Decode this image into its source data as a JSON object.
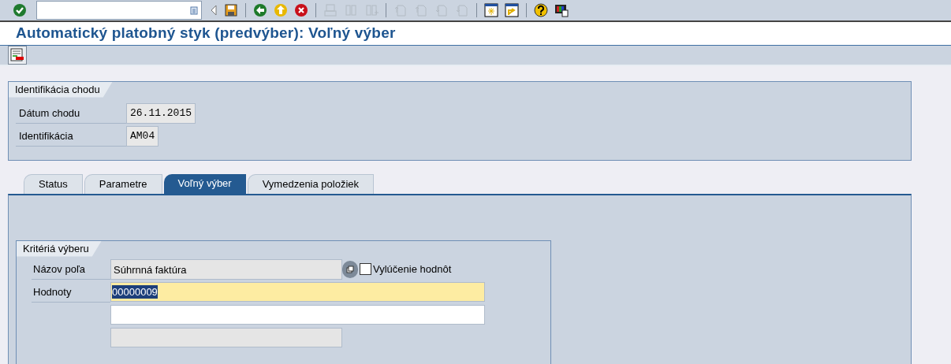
{
  "toolbar": [
    {
      "kind": "enter",
      "disabled": false
    },
    {
      "kind": "command-field",
      "disabled": false
    },
    {
      "kind": "save",
      "disabled": false
    },
    {
      "kind": "back",
      "disabled": false
    },
    {
      "kind": "exit",
      "disabled": false
    },
    {
      "kind": "cancel",
      "disabled": false
    },
    {
      "kind": "print",
      "disabled": true
    },
    {
      "kind": "find",
      "disabled": true
    },
    {
      "kind": "find-next",
      "disabled": true
    },
    {
      "kind": "first-page",
      "disabled": true
    },
    {
      "kind": "prev-page",
      "disabled": true
    },
    {
      "kind": "next-page",
      "disabled": true
    },
    {
      "kind": "last-page",
      "disabled": true
    },
    {
      "kind": "new-session",
      "disabled": false
    },
    {
      "kind": "shortcut",
      "disabled": false
    },
    {
      "kind": "help",
      "disabled": false
    },
    {
      "kind": "layout",
      "disabled": false
    }
  ],
  "title": "Automatický platobný styk (predvýber): Voľný výber",
  "run_group": {
    "title": "Identifikácia chodu",
    "rows": [
      {
        "label": "Dátum chodu",
        "value": "26.11.2015"
      },
      {
        "label": "Identifikácia",
        "value": "AM04"
      }
    ]
  },
  "tabs": [
    {
      "label": "Status",
      "selected": false
    },
    {
      "label": "Parametre",
      "selected": false
    },
    {
      "label": "Voľný výber",
      "selected": true
    },
    {
      "label": "Vymedzenia položiek",
      "selected": false
    }
  ],
  "criteria": {
    "title": "Kritériá výberu",
    "field_name": {
      "label": "Názov poľa",
      "value": "Súhrnná faktúra"
    },
    "exclude": {
      "label": "Vylúčenie hodnôt",
      "checked": false
    },
    "values": {
      "label": "Hodnoty",
      "value": "00000009",
      "selected": true
    }
  }
}
